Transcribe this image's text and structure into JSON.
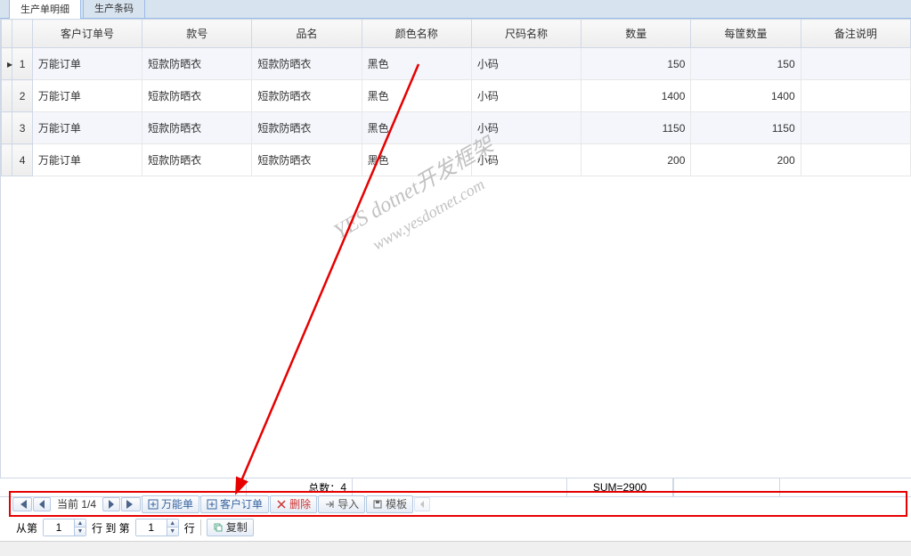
{
  "tabs": [
    {
      "label": "生产单明细",
      "active": true
    },
    {
      "label": "生产条码",
      "active": false
    }
  ],
  "columns": [
    "客户订单号",
    "款号",
    "品名",
    "颜色名称",
    "尺码名称",
    "数量",
    "每筐数量",
    "备注说明"
  ],
  "rows": [
    {
      "idx": "1",
      "order": "万能订单",
      "style": "短款防晒衣",
      "name": "短款防晒衣",
      "color": "黑色",
      "size": "小码",
      "qty": "150",
      "per": "150",
      "note": ""
    },
    {
      "idx": "2",
      "order": "万能订单",
      "style": "短款防晒衣",
      "name": "短款防晒衣",
      "color": "黑色",
      "size": "小码",
      "qty": "1400",
      "per": "1400",
      "note": ""
    },
    {
      "idx": "3",
      "order": "万能订单",
      "style": "短款防晒衣",
      "name": "短款防晒衣",
      "color": "黑色",
      "size": "小码",
      "qty": "1150",
      "per": "1150",
      "note": ""
    },
    {
      "idx": "4",
      "order": "万能订单",
      "style": "短款防晒衣",
      "name": "短款防晒衣",
      "color": "黑色",
      "size": "小码",
      "qty": "200",
      "per": "200",
      "note": ""
    }
  ],
  "totals": {
    "count_label": "总数：",
    "count_value": "4",
    "sum_label": "SUM=2900"
  },
  "pager": {
    "label": "当前 1/4"
  },
  "toolbar": {
    "wanneng": "万能单",
    "kehu": "客户订单",
    "delete": "删除",
    "import": "导入",
    "template": "模板"
  },
  "copyrow": {
    "from_label": "从第",
    "to_label": "行 到 第",
    "row_label": "行",
    "copy_label": "复制",
    "from_value": "1",
    "to_value": "1"
  },
  "watermark": {
    "line1": "YES dotnet开发框架",
    "line2": "www.yesdotnet.com"
  }
}
